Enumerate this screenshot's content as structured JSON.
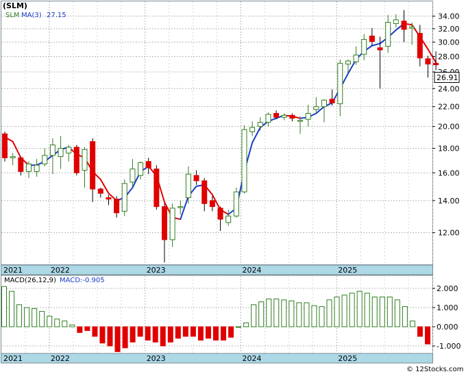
{
  "symbol_label": "(SLM)",
  "legend": {
    "ma_name": "SLM",
    "ma_label": "MA(3)",
    "ma_value": "27.15"
  },
  "macd_legend": {
    "name": "MACD(26,12,9)",
    "value_label": "MACD:-0.905"
  },
  "watermark": "© 12Stocks.com",
  "last_price": "26.91",
  "colors": {
    "up": "#2e7d1e",
    "down": "#e00000",
    "ma_up": "#1a3cc8",
    "ma_down": "#e00000",
    "axis_band": "#add8e6"
  },
  "chart_data": [
    {
      "type": "candlestick",
      "title": "(SLM)",
      "y_scale": "log",
      "yticks": [
        "34.00",
        "32.00",
        "30.00",
        "28.00",
        "26.00",
        "24.00",
        "22.00",
        "20.00",
        "18.00",
        "16.00",
        "14.00",
        "12.00"
      ],
      "ylim": [
        10.3,
        36.5
      ],
      "x_labels": [
        "2021",
        "2022",
        "2023",
        "2024",
        "2025"
      ],
      "x_label_index": [
        0,
        6,
        18,
        30,
        42
      ],
      "ohlc": [
        [
          19.3,
          19.5,
          16.9,
          17.2
        ],
        [
          17.2,
          17.6,
          16.6,
          17.3
        ],
        [
          17.2,
          17.3,
          15.8,
          16.1
        ],
        [
          16.1,
          16.9,
          15.6,
          16.7
        ],
        [
          16.1,
          17.1,
          15.7,
          16.6
        ],
        [
          16.7,
          18.0,
          16.5,
          17.4
        ],
        [
          17.4,
          18.9,
          15.9,
          18.3
        ],
        [
          17.3,
          19.1,
          16.3,
          18.0
        ],
        [
          17.6,
          18.3,
          16.9,
          18.1
        ],
        [
          18.1,
          18.3,
          15.8,
          16.0
        ],
        [
          16.2,
          18.1,
          14.9,
          17.9
        ],
        [
          18.6,
          18.9,
          13.9,
          14.8
        ],
        [
          14.8,
          14.9,
          14.2,
          14.5
        ],
        [
          14.2,
          14.4,
          13.7,
          14.1
        ],
        [
          14.1,
          14.3,
          12.9,
          13.2
        ],
        [
          13.3,
          15.5,
          13.0,
          15.2
        ],
        [
          15.3,
          17.1,
          14.9,
          16.3
        ],
        [
          15.8,
          16.9,
          15.5,
          16.8
        ],
        [
          16.9,
          17.2,
          15.9,
          16.4
        ],
        [
          16.3,
          16.6,
          13.4,
          13.6
        ],
        [
          13.6,
          13.8,
          10.4,
          11.6
        ],
        [
          11.6,
          13.8,
          11.2,
          13.5
        ],
        [
          13.6,
          14.0,
          13.1,
          13.6
        ],
        [
          14.2,
          16.5,
          13.8,
          15.9
        ],
        [
          15.8,
          16.2,
          15.1,
          15.4
        ],
        [
          15.4,
          15.6,
          13.3,
          13.8
        ],
        [
          14.0,
          14.3,
          13.3,
          13.6
        ],
        [
          13.5,
          13.6,
          12.1,
          12.8
        ],
        [
          12.6,
          13.4,
          12.4,
          13.0
        ],
        [
          13.0,
          14.9,
          12.9,
          14.6
        ],
        [
          14.6,
          20.1,
          14.5,
          19.7
        ],
        [
          19.5,
          20.5,
          19.1,
          19.9
        ],
        [
          20.0,
          20.9,
          19.6,
          20.4
        ],
        [
          20.4,
          21.4,
          20.0,
          21.2
        ],
        [
          21.3,
          21.6,
          20.7,
          20.9
        ],
        [
          20.9,
          21.3,
          20.6,
          21.1
        ],
        [
          21.1,
          21.3,
          20.5,
          20.8
        ],
        [
          20.6,
          21.0,
          19.3,
          20.6
        ],
        [
          20.7,
          22.2,
          20.0,
          21.3
        ],
        [
          21.7,
          23.0,
          21.3,
          22.0
        ],
        [
          22.0,
          22.8,
          20.4,
          22.7
        ],
        [
          22.8,
          23.9,
          22.1,
          22.4
        ],
        [
          22.3,
          27.6,
          21.0,
          27.1
        ],
        [
          27.0,
          27.6,
          25.9,
          27.4
        ],
        [
          27.3,
          29.4,
          26.9,
          28.2
        ],
        [
          28.3,
          31.2,
          27.5,
          30.4
        ],
        [
          30.9,
          32.1,
          29.5,
          30.1
        ],
        [
          29.2,
          30.8,
          24.0,
          28.9
        ],
        [
          29.4,
          34.2,
          28.5,
          33.0
        ],
        [
          32.8,
          34.3,
          32.2,
          33.4
        ],
        [
          33.2,
          35.0,
          30.0,
          31.9
        ],
        [
          32.1,
          33.0,
          29.6,
          32.3
        ],
        [
          31.3,
          32.6,
          26.7,
          27.8
        ],
        [
          27.7,
          28.1,
          25.3,
          27.0
        ],
        [
          27.1,
          28.7,
          26.2,
          26.9
        ]
      ],
      "ma3": [
        19.0,
        18.6,
        17.2,
        16.6,
        16.6,
        16.9,
        17.4,
        17.9,
        18.1,
        17.5,
        17.2,
        16.1,
        15.5,
        14.5,
        14.0,
        14.2,
        14.9,
        16.1,
        16.5,
        15.8,
        13.9,
        12.9,
        12.8,
        14.3,
        15.0,
        15.1,
        14.4,
        13.4,
        13.1,
        13.5,
        16.1,
        18.5,
        19.9,
        20.5,
        20.8,
        21.1,
        21.0,
        20.8,
        20.9,
        21.3,
        22.0,
        22.4,
        24.0,
        25.8,
        27.6,
        28.7,
        29.5,
        29.8,
        30.7,
        31.8,
        32.8,
        32.6,
        30.8,
        29.0,
        27.2
      ]
    },
    {
      "type": "bar",
      "title": "MACD(26,12,9)",
      "yticks": [
        "2.000",
        "1.000",
        "0.000",
        "-1.000"
      ],
      "ylim": [
        -1.35,
        2.2
      ],
      "x_labels": [
        "2021",
        "2022",
        "2023",
        "2024",
        "2025"
      ],
      "values": [
        2.1,
        1.85,
        1.15,
        1.0,
        0.95,
        0.8,
        0.55,
        0.4,
        0.3,
        0.1,
        -0.3,
        -0.2,
        -0.5,
        -0.85,
        -1.0,
        -1.3,
        -1.1,
        -0.8,
        -0.5,
        -0.7,
        -0.8,
        -1.0,
        -0.8,
        -0.6,
        -0.5,
        -0.5,
        -0.7,
        -0.6,
        -0.7,
        -0.7,
        -0.55,
        0.0,
        0.2,
        1.15,
        1.3,
        1.45,
        1.45,
        1.4,
        1.35,
        1.25,
        1.25,
        1.1,
        1.05,
        1.4,
        1.55,
        1.65,
        1.75,
        1.85,
        1.75,
        1.55,
        1.55,
        1.55,
        1.4,
        1.05,
        0.3,
        -0.5,
        -0.9
      ]
    }
  ]
}
